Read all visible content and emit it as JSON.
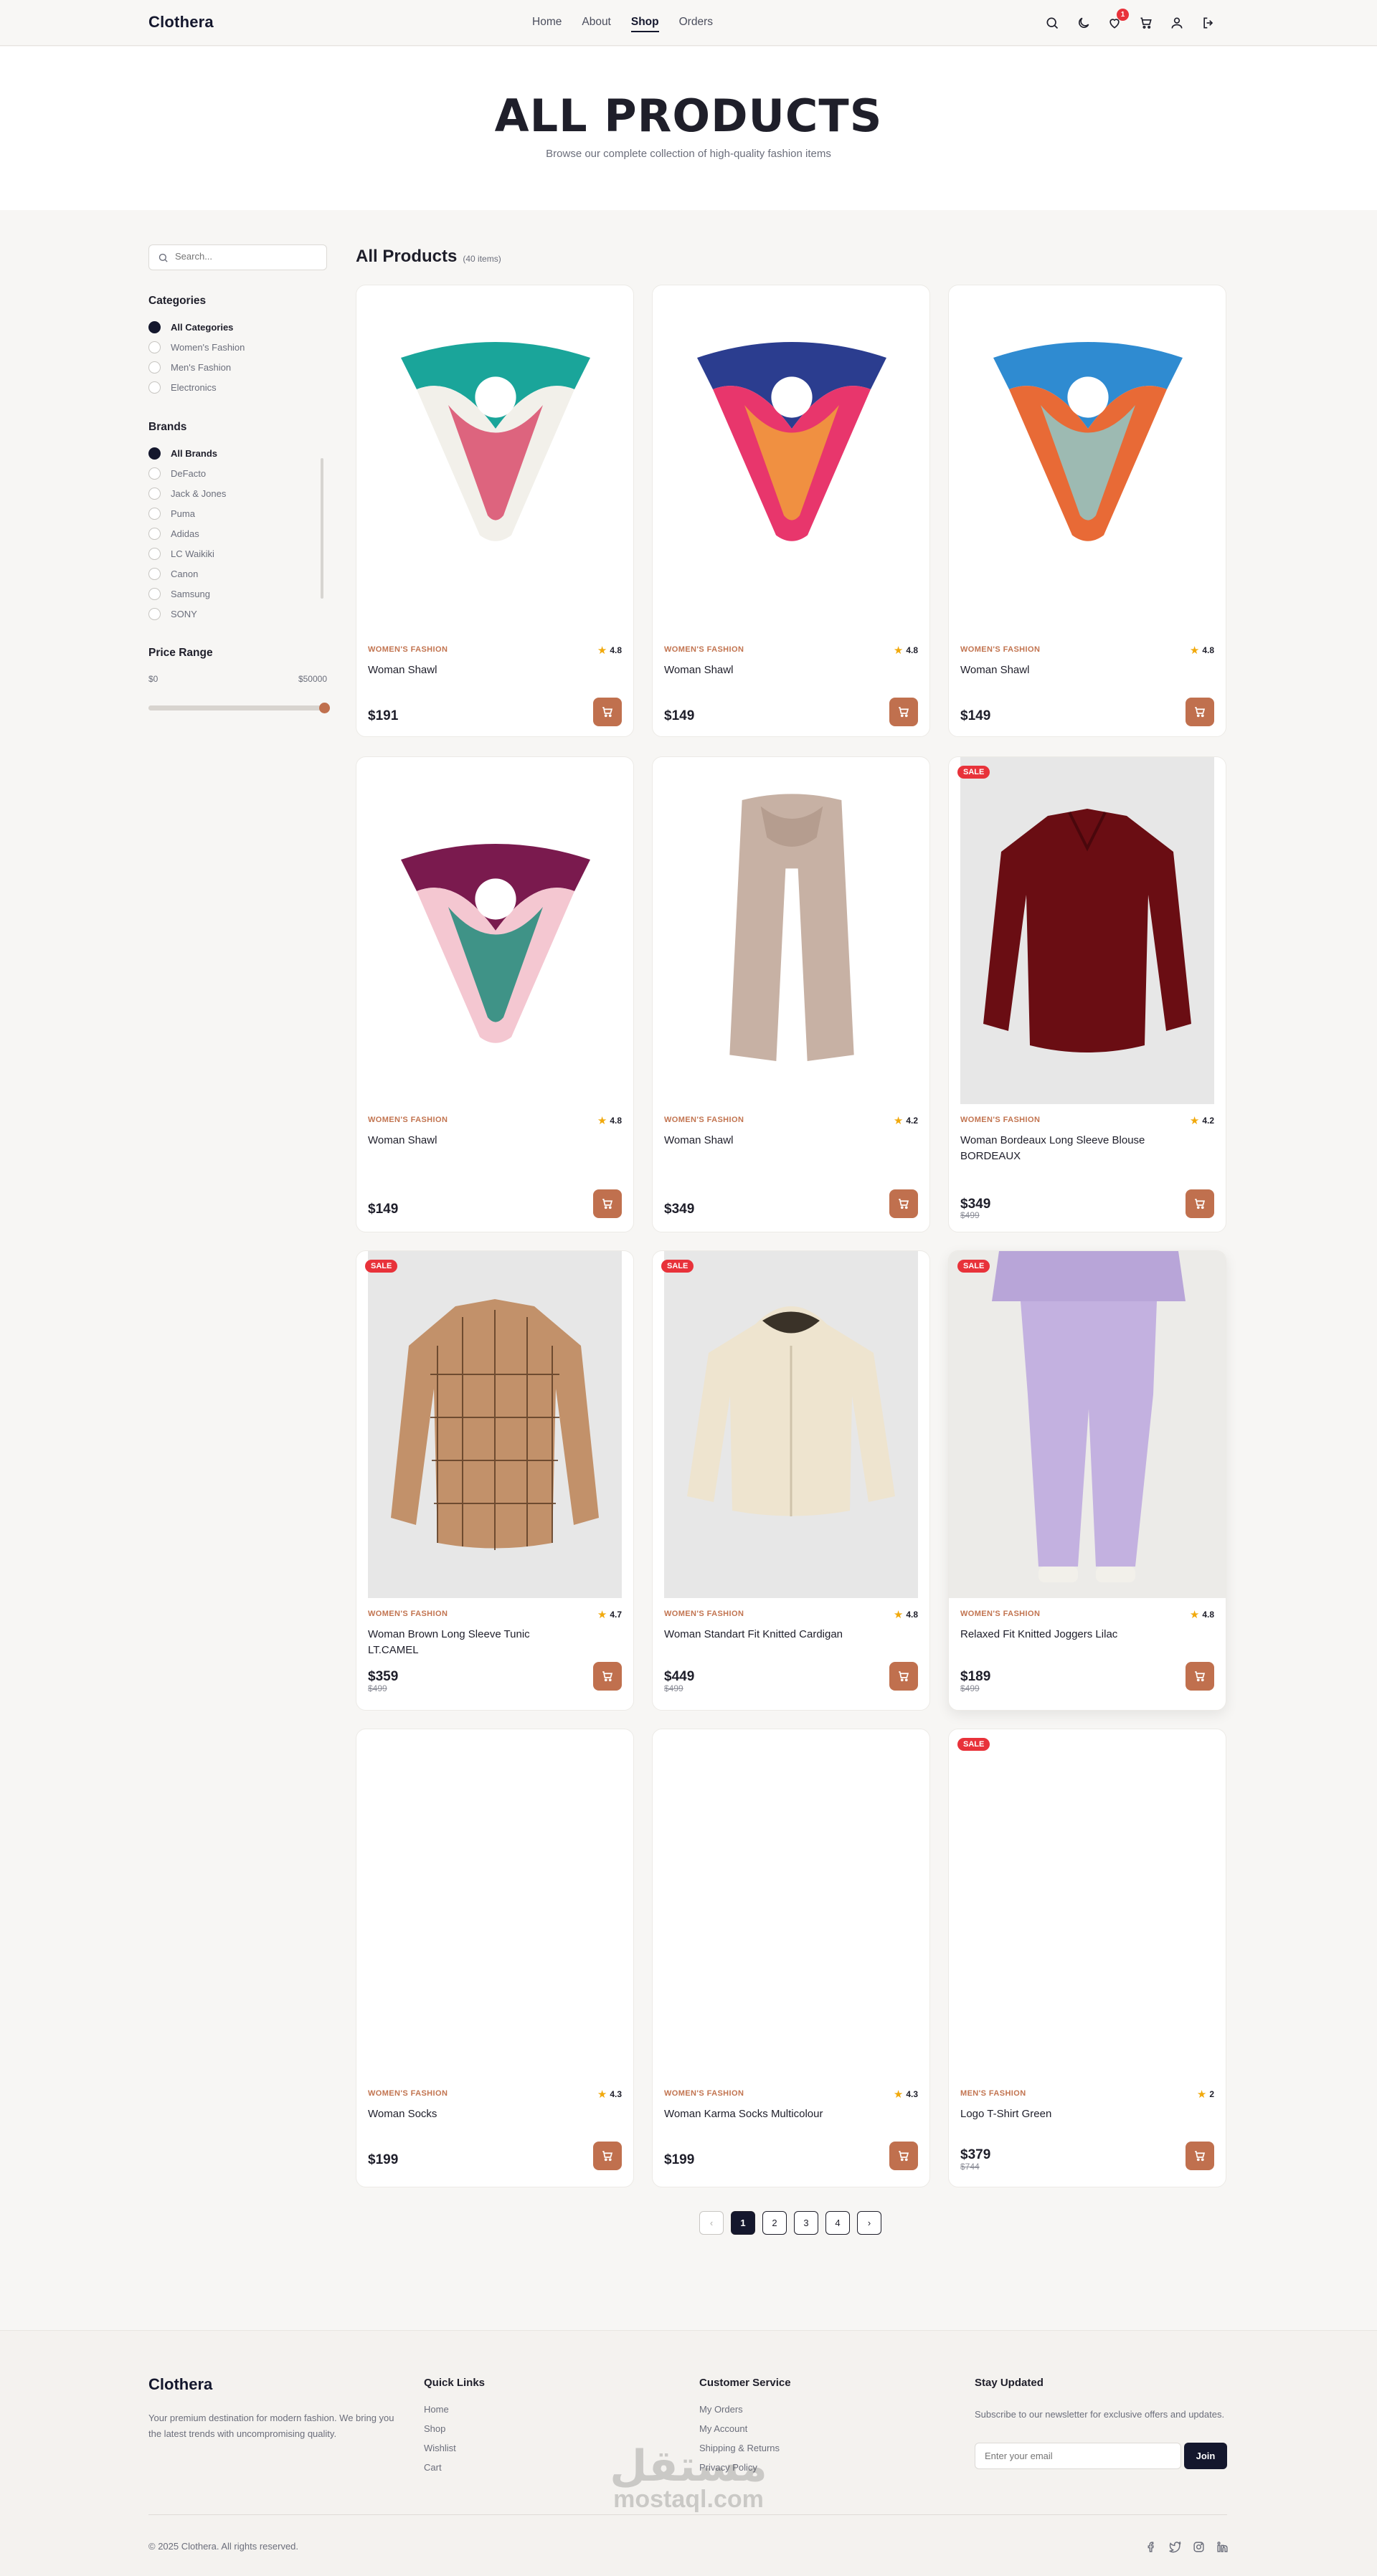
{
  "header": {
    "logo": "Clothera",
    "nav": [
      "Home",
      "About",
      "Shop",
      "Orders"
    ],
    "active_nav": "Shop",
    "wishlist_count": "1"
  },
  "hero": {
    "title": "ALL PRODUCTS",
    "subtitle": "Browse our complete collection of high-quality fashion items"
  },
  "sidebar": {
    "search_placeholder": "Search...",
    "categories_title": "Categories",
    "categories": [
      "All Categories",
      "Women's Fashion",
      "Men's Fashion",
      "Electronics"
    ],
    "selected_category": "All Categories",
    "brands_title": "Brands",
    "brands": [
      "All Brands",
      "DeFacto",
      "Jack & Jones",
      "Puma",
      "Adidas",
      "LC Waikiki",
      "Canon",
      "Samsung",
      "SONY"
    ],
    "selected_brand": "All Brands",
    "price_title": "Price Range",
    "price_min": "$0",
    "price_max": "$50000",
    "price_slider_fraction": 1.0
  },
  "listing": {
    "title": "All Products",
    "count": "(40 items)",
    "products": [
      {
        "category": "WOMEN'S FASHION",
        "rating": "4.8",
        "name": "Woman Shawl",
        "price": "$191",
        "old_price": "",
        "sale": false,
        "image": "scarf-teal-floral",
        "grey": false
      },
      {
        "category": "WOMEN'S FASHION",
        "rating": "4.8",
        "name": "Woman Shawl",
        "price": "$149",
        "old_price": "",
        "sale": false,
        "image": "scarf-blue-pink",
        "grey": false
      },
      {
        "category": "WOMEN'S FASHION",
        "rating": "4.8",
        "name": "Woman Shawl",
        "price": "$149",
        "old_price": "",
        "sale": false,
        "image": "scarf-orange-blue",
        "grey": false
      },
      {
        "category": "WOMEN'S FASHION",
        "rating": "4.8",
        "name": "Woman Shawl",
        "price": "$149",
        "old_price": "",
        "sale": false,
        "image": "scarf-purple-pink",
        "grey": false
      },
      {
        "category": "WOMEN'S FASHION",
        "rating": "4.2",
        "name": "Woman Shawl",
        "price": "$349",
        "old_price": "",
        "sale": false,
        "image": "scarf-beige-long",
        "grey": false
      },
      {
        "category": "WOMEN'S FASHION",
        "rating": "4.2",
        "name": "Woman Bordeaux Long Sleeve Blouse BORDEAUX",
        "price": "$349",
        "old_price": "$499",
        "sale": true,
        "sale_label": "SALE",
        "image": "blouse-bordeaux",
        "grey": true
      },
      {
        "category": "WOMEN'S FASHION",
        "rating": "4.7",
        "name": "Woman Brown Long Sleeve Tunic LT.CAMEL",
        "price": "$359",
        "old_price": "$499",
        "sale": true,
        "sale_label": "SALE",
        "image": "tunic-camel",
        "grey": true
      },
      {
        "category": "WOMEN'S FASHION",
        "rating": "4.8",
        "name": "Woman Standart Fit Knitted Cardigan",
        "price": "$449",
        "old_price": "$499",
        "sale": true,
        "sale_label": "SALE",
        "image": "cardigan-cream",
        "grey": true
      },
      {
        "category": "WOMEN'S FASHION",
        "rating": "4.8",
        "name": "Relaxed Fit Knitted Joggers Lilac",
        "price": "$189",
        "old_price": "$499",
        "sale": true,
        "sale_label": "SALE",
        "image": "joggers-lilac",
        "grey": true
      },
      {
        "category": "WOMEN'S FASHION",
        "rating": "4.3",
        "name": "Woman Socks",
        "price": "$199",
        "old_price": "",
        "sale": false,
        "image": "blank",
        "grey": false
      },
      {
        "category": "WOMEN'S FASHION",
        "rating": "4.3",
        "name": "Woman Karma Socks Multicolour",
        "price": "$199",
        "old_price": "",
        "sale": false,
        "image": "blank",
        "grey": false
      },
      {
        "category": "MEN'S FASHION",
        "rating": "2",
        "name": "Logo T-Shirt Green",
        "price": "$379",
        "old_price": "$744",
        "sale": true,
        "sale_label": "SALE",
        "image": "blank",
        "grey": false
      }
    ]
  },
  "pagination": {
    "prev": "‹",
    "pages": [
      "1",
      "2",
      "3",
      "4"
    ],
    "current": "1",
    "next": "›"
  },
  "footer": {
    "logo": "Clothera",
    "tagline": "Your premium destination for modern fashion. We bring you the latest trends with uncompromising quality.",
    "quick_links_title": "Quick Links",
    "quick_links": [
      "Home",
      "Shop",
      "Wishlist",
      "Cart"
    ],
    "customer_service_title": "Customer Service",
    "customer_service": [
      "My Orders",
      "My Account",
      "Shipping & Returns",
      "Privacy Policy"
    ],
    "newsletter_title": "Stay Updated",
    "newsletter_text": "Subscribe to our newsletter for exclusive offers and updates.",
    "email_placeholder": "Enter your email",
    "join_label": "Join",
    "copyright": "© 2025 Clothera. All rights reserved.",
    "social_icons": [
      "facebook-icon",
      "twitter-icon",
      "instagram-icon",
      "linkedin-icon"
    ]
  },
  "watermark": {
    "arabic": "مستقل",
    "latin": "mostaql.com"
  },
  "colors": {
    "accent": "#c0704e",
    "navy": "#14172d",
    "sale": "#e8323a",
    "star": "#f1a90c"
  }
}
